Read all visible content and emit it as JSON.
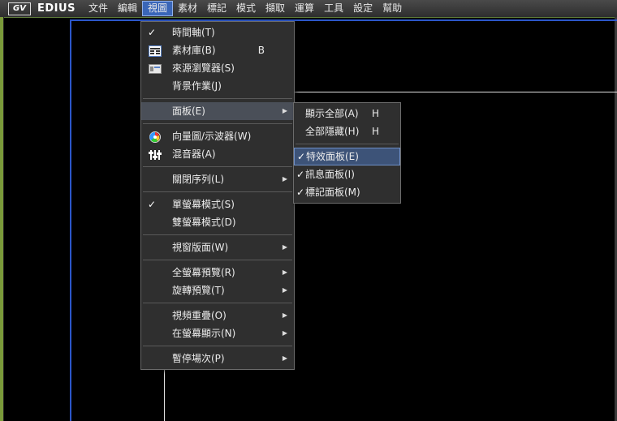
{
  "app": {
    "logo": "GV",
    "brand": "EDIUS"
  },
  "menubar": {
    "items": [
      "文件",
      "編輯",
      "視圖",
      "素材",
      "標記",
      "模式",
      "擷取",
      "運算",
      "工具",
      "設定",
      "幫助"
    ],
    "active": "視圖"
  },
  "view_menu": {
    "items": [
      {
        "label": "時間軸(T)",
        "checked": true
      },
      {
        "label": "素材庫(B)",
        "shortcut": "B",
        "icon": "bin-icon"
      },
      {
        "label": "來源瀏覽器(S)",
        "icon": "source-browser-icon"
      },
      {
        "label": "背景作業(J)"
      },
      {
        "label": "面板(E)",
        "submenu": true,
        "highlighted": true
      },
      {
        "label": "向量圖/示波器(W)",
        "icon": "vectorscope-icon"
      },
      {
        "label": "混音器(A)",
        "icon": "mixer-icon"
      },
      {
        "label": "關閉序列(L)",
        "submenu": true
      },
      {
        "label": "單螢幕模式(S)",
        "checked": true
      },
      {
        "label": "雙螢幕模式(D)"
      },
      {
        "label": "視窗版面(W)",
        "submenu": true
      },
      {
        "label": "全螢幕預覽(R)",
        "submenu": true
      },
      {
        "label": "旋轉預覽(T)",
        "submenu": true
      },
      {
        "label": "視頻重疊(O)",
        "submenu": true
      },
      {
        "label": "在螢幕顯示(N)",
        "submenu": true
      },
      {
        "label": "暫停場次(P)",
        "submenu": true
      }
    ]
  },
  "panel_submenu": {
    "items": [
      {
        "label": "顯示全部(A)",
        "shortcut": "H"
      },
      {
        "label": "全部隱藏(H)",
        "shortcut": "H"
      },
      {
        "label": "特效面板(E)",
        "checked": true,
        "highlighted": true
      },
      {
        "label": "訊息面板(I)",
        "checked": true
      },
      {
        "label": "標記面板(M)",
        "checked": true
      }
    ]
  },
  "colors": {
    "menu_highlight": "#3a66b8",
    "preview_border": "#2b56c9",
    "accent_green": "#7a9a3a"
  }
}
